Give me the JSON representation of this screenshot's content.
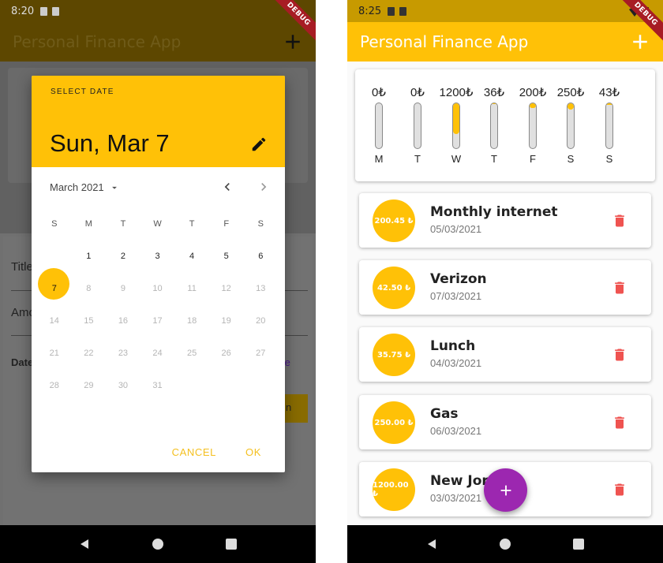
{
  "left_screen": {
    "status_time": "8:20",
    "debug_label": "DEBUG",
    "app_title": "Personal Finance App",
    "background_form": {
      "title_label": "Title",
      "amount_label": "Amo",
      "date_label": "Date",
      "choose_date_partial": "te",
      "submit_partial": "n"
    },
    "date_picker": {
      "help_text": "SELECT DATE",
      "selected_date": "Sun, Mar 7",
      "month_label": "March 2021",
      "weekday_headers": [
        "S",
        "M",
        "T",
        "W",
        "T",
        "F",
        "S"
      ],
      "weeks": [
        [
          "",
          "1",
          "2",
          "3",
          "4",
          "5",
          "6"
        ],
        [
          "7",
          "8",
          "9",
          "10",
          "11",
          "12",
          "13"
        ],
        [
          "14",
          "15",
          "16",
          "17",
          "18",
          "19",
          "20"
        ],
        [
          "21",
          "22",
          "23",
          "24",
          "25",
          "26",
          "27"
        ],
        [
          "28",
          "29",
          "30",
          "31",
          "",
          "",
          ""
        ]
      ],
      "selected_day": "7",
      "cancel_label": "CANCEL",
      "ok_label": "OK"
    }
  },
  "right_screen": {
    "status_time": "8:25",
    "debug_label": "DEBUG",
    "app_title": "Personal Finance App",
    "weekly_chart": [
      {
        "amount": "0₺",
        "day": "M",
        "fill": 0
      },
      {
        "amount": "0₺",
        "day": "T",
        "fill": 0
      },
      {
        "amount": "1200₺",
        "day": "W",
        "fill": 0.68
      },
      {
        "amount": "36₺",
        "day": "T",
        "fill": 0.02
      },
      {
        "amount": "200₺",
        "day": "F",
        "fill": 0.11
      },
      {
        "amount": "250₺",
        "day": "S",
        "fill": 0.14
      },
      {
        "amount": "43₺",
        "day": "S",
        "fill": 0.03
      }
    ],
    "transactions": [
      {
        "amount": "200.45 ₺",
        "title": "Monthly internet",
        "date": "05/03/2021"
      },
      {
        "amount": "42.50 ₺",
        "title": "Verizon",
        "date": "07/03/2021"
      },
      {
        "amount": "35.75 ₺",
        "title": "Lunch",
        "date": "04/03/2021"
      },
      {
        "amount": "250.00 ₺",
        "title": "Gas",
        "date": "06/03/2021"
      },
      {
        "amount": "1200.00 ₺",
        "title": "New Jor",
        "date": "03/03/2021"
      }
    ]
  },
  "colors": {
    "accent": "#ffc107",
    "fab": "#9c27b0",
    "delete": "#ef5350"
  },
  "icons": [
    "add-icon",
    "edit-pencil-icon",
    "dropdown-arrow-icon",
    "chevron-left-icon",
    "chevron-right-icon",
    "delete-icon",
    "back-nav-icon",
    "home-nav-icon",
    "recents-nav-icon",
    "wifi-icon",
    "battery-icon"
  ]
}
